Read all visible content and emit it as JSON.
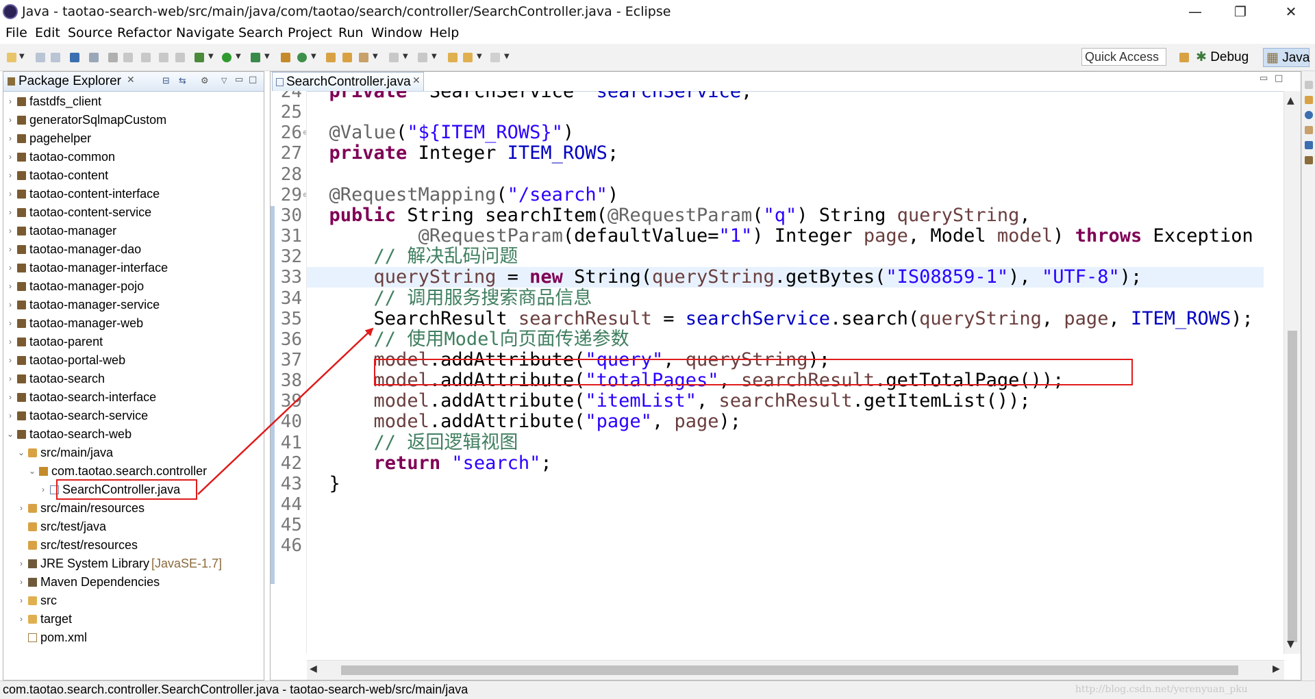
{
  "window": {
    "title": "Java - taotao-search-web/src/main/java/com/taotao/search/controller/SearchController.java - Eclipse",
    "minimize": "—",
    "maximize": "❐",
    "close": "✕"
  },
  "menu": [
    "File",
    "Edit",
    "Source",
    "Refactor",
    "Navigate",
    "Search",
    "Project",
    "Run",
    "Window",
    "Help"
  ],
  "toolbar": {
    "quick_access": "Quick Access",
    "perspectives": [
      {
        "label": "Debug",
        "active": false
      },
      {
        "label": "Java",
        "active": true
      }
    ]
  },
  "package_explorer": {
    "title": "Package Explorer",
    "items": [
      {
        "label": "fastdfs_client",
        "depth": 0,
        "icon": "project-icon",
        "expanded": false
      },
      {
        "label": "generatorSqlmapCustom",
        "depth": 0,
        "icon": "project-icon",
        "expanded": false
      },
      {
        "label": "pagehelper",
        "depth": 0,
        "icon": "project-icon",
        "expanded": false
      },
      {
        "label": "taotao-common",
        "depth": 0,
        "icon": "project-icon",
        "expanded": false
      },
      {
        "label": "taotao-content",
        "depth": 0,
        "icon": "project-icon",
        "expanded": false
      },
      {
        "label": "taotao-content-interface",
        "depth": 0,
        "icon": "project-icon",
        "expanded": false
      },
      {
        "label": "taotao-content-service",
        "depth": 0,
        "icon": "project-icon",
        "expanded": false
      },
      {
        "label": "taotao-manager",
        "depth": 0,
        "icon": "project-icon",
        "expanded": false
      },
      {
        "label": "taotao-manager-dao",
        "depth": 0,
        "icon": "project-icon",
        "expanded": false
      },
      {
        "label": "taotao-manager-interface",
        "depth": 0,
        "icon": "project-icon",
        "expanded": false
      },
      {
        "label": "taotao-manager-pojo",
        "depth": 0,
        "icon": "project-icon",
        "expanded": false
      },
      {
        "label": "taotao-manager-service",
        "depth": 0,
        "icon": "project-icon",
        "expanded": false
      },
      {
        "label": "taotao-manager-web",
        "depth": 0,
        "icon": "project-icon",
        "expanded": false
      },
      {
        "label": "taotao-parent",
        "depth": 0,
        "icon": "project-icon",
        "expanded": false
      },
      {
        "label": "taotao-portal-web",
        "depth": 0,
        "icon": "project-icon",
        "expanded": false
      },
      {
        "label": "taotao-search",
        "depth": 0,
        "icon": "project-icon",
        "expanded": false
      },
      {
        "label": "taotao-search-interface",
        "depth": 0,
        "icon": "project-icon",
        "expanded": false
      },
      {
        "label": "taotao-search-service",
        "depth": 0,
        "icon": "project-icon",
        "expanded": false
      },
      {
        "label": "taotao-search-web",
        "depth": 0,
        "icon": "project-icon",
        "expanded": true
      },
      {
        "label": "src/main/java",
        "depth": 1,
        "icon": "source-folder-icon",
        "expanded": true
      },
      {
        "label": "com.taotao.search.controller",
        "depth": 2,
        "icon": "package-icon",
        "expanded": true
      },
      {
        "label": "SearchController.java",
        "depth": 3,
        "icon": "java-file-icon",
        "expanded": false,
        "selected": true
      },
      {
        "label": "src/main/resources",
        "depth": 1,
        "icon": "source-folder-icon",
        "expanded": false
      },
      {
        "label": "src/test/java",
        "depth": 1,
        "icon": "source-folder-icon",
        "leaf": true
      },
      {
        "label": "src/test/resources",
        "depth": 1,
        "icon": "source-folder-icon",
        "leaf": true
      },
      {
        "label": "JRE System Library",
        "suffix": "[JavaSE-1.7]",
        "depth": 1,
        "icon": "library-icon",
        "expanded": false
      },
      {
        "label": "Maven Dependencies",
        "depth": 1,
        "icon": "library-icon",
        "expanded": false
      },
      {
        "label": "src",
        "depth": 1,
        "icon": "folder-icon",
        "expanded": false
      },
      {
        "label": "target",
        "depth": 1,
        "icon": "folder-icon",
        "expanded": false
      },
      {
        "label": "pom.xml",
        "depth": 1,
        "icon": "xml-file-icon",
        "leaf": true
      }
    ]
  },
  "editor": {
    "tab_label": "SearchController.java",
    "current_line": 33,
    "lines": [
      {
        "n": "24",
        "tokens": [
          [
            "kw",
            "private"
          ],
          [
            "",
            "  SearchService  "
          ],
          [
            "fld",
            "searchService"
          ],
          [
            "",
            ";"
          ]
        ]
      },
      {
        "n": "25",
        "tokens": []
      },
      {
        "n": "26",
        "fold": true,
        "tokens": [
          [
            "ann",
            "@Value"
          ],
          [
            "",
            "("
          ],
          [
            "str",
            "\"${ITEM_ROWS}\""
          ],
          [
            "",
            ")"
          ]
        ]
      },
      {
        "n": "27",
        "tokens": [
          [
            "kw",
            "private"
          ],
          [
            "",
            " Integer "
          ],
          [
            "fld",
            "ITEM_ROWS"
          ],
          [
            "",
            ";"
          ]
        ]
      },
      {
        "n": "28",
        "tokens": []
      },
      {
        "n": "29",
        "fold": true,
        "tokens": [
          [
            "ann",
            "@RequestMapping"
          ],
          [
            "",
            "("
          ],
          [
            "str",
            "\"/search\""
          ],
          [
            "",
            ")"
          ]
        ]
      },
      {
        "n": "30",
        "tokens": [
          [
            "kw",
            "public"
          ],
          [
            "",
            " String searchItem("
          ],
          [
            "ann",
            "@RequestParam"
          ],
          [
            "",
            "("
          ],
          [
            "str",
            "\"q\""
          ],
          [
            "",
            ") String "
          ],
          [
            "loc",
            "queryString"
          ],
          [
            "",
            ","
          ]
        ]
      },
      {
        "n": "31",
        "tokens": [
          [
            "",
            "        "
          ],
          [
            "ann",
            "@RequestParam"
          ],
          [
            "",
            "(defaultValue="
          ],
          [
            "str",
            "\"1\""
          ],
          [
            "",
            ") Integer "
          ],
          [
            "loc",
            "page"
          ],
          [
            "",
            ", Model "
          ],
          [
            "loc",
            "model"
          ],
          [
            "",
            ") "
          ],
          [
            "kw",
            "throws"
          ],
          [
            "",
            " Exception {"
          ]
        ]
      },
      {
        "n": "32",
        "tokens": [
          [
            "",
            "    "
          ],
          [
            "cmt",
            "// 解决乱码问题"
          ]
        ]
      },
      {
        "n": "33",
        "tokens": [
          [
            "",
            "    "
          ],
          [
            "loc",
            "queryString"
          ],
          [
            "",
            " = "
          ],
          [
            "kw",
            "new"
          ],
          [
            "",
            " String("
          ],
          [
            "loc",
            "queryString"
          ],
          [
            "",
            ".getBytes("
          ],
          [
            "str",
            "\"IS08859-1\""
          ],
          [
            "",
            "), "
          ],
          [
            "str",
            "\"UTF-8\""
          ],
          [
            "",
            ");"
          ]
        ]
      },
      {
        "n": "34",
        "tokens": [
          [
            "",
            "    "
          ],
          [
            "cmt",
            "// 调用服务搜索商品信息"
          ]
        ]
      },
      {
        "n": "35",
        "tokens": [
          [
            "",
            "    SearchResult "
          ],
          [
            "loc",
            "searchResult"
          ],
          [
            "",
            " = "
          ],
          [
            "fld",
            "searchService"
          ],
          [
            "",
            ".search("
          ],
          [
            "loc",
            "queryString"
          ],
          [
            "",
            ", "
          ],
          [
            "loc",
            "page"
          ],
          [
            "",
            ", "
          ],
          [
            "fld",
            "ITEM_ROWS"
          ],
          [
            "",
            ");"
          ]
        ]
      },
      {
        "n": "36",
        "tokens": [
          [
            "",
            "    "
          ],
          [
            "cmt",
            "// 使用Model向页面传递参数"
          ]
        ]
      },
      {
        "n": "37",
        "tokens": [
          [
            "",
            "    "
          ],
          [
            "loc",
            "model"
          ],
          [
            "",
            ".addAttribute("
          ],
          [
            "str",
            "\"query\""
          ],
          [
            "",
            ", "
          ],
          [
            "loc",
            "queryString"
          ],
          [
            "",
            ");"
          ]
        ]
      },
      {
        "n": "38",
        "tokens": [
          [
            "",
            "    "
          ],
          [
            "loc",
            "model"
          ],
          [
            "",
            ".addAttribute("
          ],
          [
            "str",
            "\"totalPages\""
          ],
          [
            "",
            ", "
          ],
          [
            "loc",
            "searchResult"
          ],
          [
            "",
            ".getTotalPage());"
          ]
        ]
      },
      {
        "n": "39",
        "tokens": [
          [
            "",
            "    "
          ],
          [
            "loc",
            "model"
          ],
          [
            "",
            ".addAttribute("
          ],
          [
            "str",
            "\"itemList\""
          ],
          [
            "",
            ", "
          ],
          [
            "loc",
            "searchResult"
          ],
          [
            "",
            ".getItemList());"
          ]
        ]
      },
      {
        "n": "40",
        "tokens": [
          [
            "",
            "    "
          ],
          [
            "loc",
            "model"
          ],
          [
            "",
            ".addAttribute("
          ],
          [
            "str",
            "\"page\""
          ],
          [
            "",
            ", "
          ],
          [
            "loc",
            "page"
          ],
          [
            "",
            ");"
          ]
        ]
      },
      {
        "n": "41",
        "tokens": [
          [
            "",
            "    "
          ],
          [
            "cmt",
            "// 返回逻辑视图"
          ]
        ]
      },
      {
        "n": "42",
        "tokens": [
          [
            "",
            "    "
          ],
          [
            "kw",
            "return"
          ],
          [
            "",
            " "
          ],
          [
            "str",
            "\"search\""
          ],
          [
            "",
            ";"
          ]
        ]
      },
      {
        "n": "43",
        "tokens": [
          [
            "",
            "}"
          ]
        ]
      },
      {
        "n": "44",
        "tokens": []
      },
      {
        "n": "45",
        "tokens": []
      },
      {
        "n": "46",
        "tokens": []
      }
    ]
  },
  "status_bar": {
    "text": "com.taotao.search.controller.SearchController.java - taotao-search-web/src/main/java",
    "watermark": "http://blog.csdn.net/yerenyuan_pku"
  },
  "colors": {
    "annotation_red": "#e01b1b",
    "keyword": "#7f0055",
    "string": "#2a00ff",
    "field": "#0000c0",
    "comment": "#3f7f5f"
  }
}
